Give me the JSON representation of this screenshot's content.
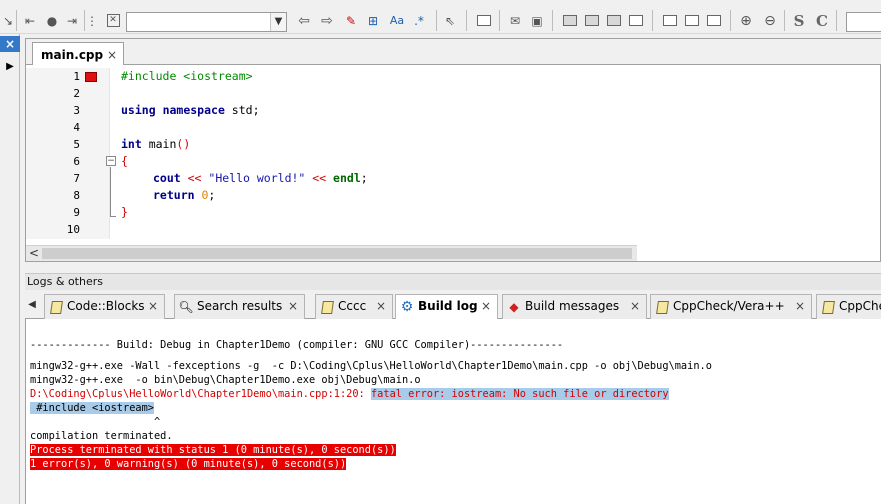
{
  "editor": {
    "tab_label": "main.cpp",
    "tab_close": "×",
    "line_numbers": [
      "1",
      "2",
      "3",
      "4",
      "5",
      "6",
      "7",
      "8",
      "9",
      "10"
    ],
    "code": {
      "l1": "#include <iostream>",
      "l3_kw1": "using",
      "l3_kw2": "namespace",
      "l3_rest": " std;",
      "l5_kw": "int",
      "l5_name": " main",
      "l5_paren": "()",
      "l6": "{",
      "l7_a": "cout",
      "l7_b": " << ",
      "l7_c": "\"Hello world!\"",
      "l7_d": " << ",
      "l7_e": "endl",
      "l7_f": ";",
      "l8_kw": "return",
      "l8_num": "0",
      "l8_end": ";",
      "l9": "}"
    },
    "fold_glyph": "−",
    "scroll_left": "<"
  },
  "logs": {
    "header": "Logs & others",
    "tab_arrow": "◀",
    "tabs": [
      {
        "label": "Code::Blocks",
        "icon": "pencil-icon"
      },
      {
        "label": "Search results",
        "icon": "magnifier-icon"
      },
      {
        "label": "Cccc",
        "icon": "pencil-icon"
      },
      {
        "label": "Build log",
        "icon": "gear-icon"
      },
      {
        "label": "Build messages",
        "icon": "pin-icon"
      },
      {
        "label": "CppCheck/Vera++",
        "icon": "pencil-icon"
      },
      {
        "label": "CppChe",
        "icon": "pencil-icon"
      }
    ],
    "close": "×",
    "lines": {
      "l1": "------------- Build: Debug in Chapter1Demo (compiler: GNU GCC Compiler)---------------",
      "l2": "mingw32-g++.exe -Wall -fexceptions -g  -c D:\\Coding\\Cplus\\HelloWorld\\Chapter1Demo\\main.cpp -o obj\\Debug\\main.o",
      "l3": "mingw32-g++.exe  -o bin\\Debug\\Chapter1Demo.exe obj\\Debug\\main.o",
      "l4_path": "D:\\Coding\\Cplus\\HelloWorld\\Chapter1Demo\\main.cpp:1:20: ",
      "l4_msg": "fatal error: iostream: No such file or directory",
      "l5": " #include <iostream>",
      "l6": "                    ^",
      "l7": "compilation terminated.",
      "l8": "Process terminated with status 1 (0 minute(s), 0 second(s))",
      "l9": "1 error(s), 0 warning(s) (0 minute(s), 0 second(s))"
    }
  },
  "toolbar": {
    "find_text": "",
    "font_s": "S",
    "font_c": "C",
    "abc": "Aa",
    "regex": ".*"
  },
  "left_strip": {
    "close": "×",
    "arrow": "▶"
  },
  "colors": {
    "error_red": "#e80000",
    "highlight_blue": "#a9cbea",
    "accent_blue": "#3478c8"
  }
}
